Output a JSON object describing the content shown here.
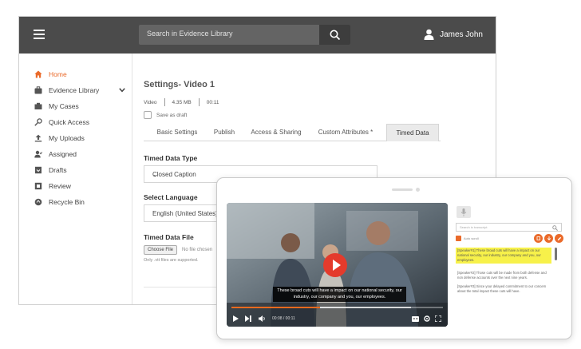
{
  "header": {
    "search_placeholder": "Search in Evidence Library",
    "user_name": "James John"
  },
  "sidebar": {
    "items": [
      {
        "label": "Home",
        "icon": "home-icon",
        "active": true
      },
      {
        "label": "Evidence Library",
        "icon": "briefcase-icon",
        "expandable": true
      },
      {
        "label": "My Cases",
        "icon": "case-icon"
      },
      {
        "label": "Quick Access",
        "icon": "key-icon"
      },
      {
        "label": "My Uploads",
        "icon": "upload-icon"
      },
      {
        "label": "Assigned",
        "icon": "assigned-user-icon"
      },
      {
        "label": "Drafts",
        "icon": "drafts-icon"
      },
      {
        "label": "Review",
        "icon": "review-icon"
      },
      {
        "label": "Recycle Bin",
        "icon": "recycle-icon"
      }
    ]
  },
  "main": {
    "title": "Settings- Video 1",
    "meta": {
      "type": "Video",
      "size": "4.35 MB",
      "duration": "00:11"
    },
    "draft_label": "Save as draft",
    "tabs": [
      "Basic Settings",
      "Publish",
      "Access & Sharing",
      "Custom Attributes *",
      "Timed Data"
    ],
    "active_tab": "Timed Data",
    "timed_data_type": {
      "label": "Timed Data Type",
      "value": "Closed Caption"
    },
    "language": {
      "label": "Select Language",
      "value": "English (United States)"
    },
    "timed_data_file": {
      "label": "Timed Data File",
      "button": "Choose File",
      "status": "No file chosen",
      "note": "Only .vtt files are supported."
    }
  },
  "player": {
    "caption": "These broad cuts will have a impact on our national security, our industry, our company and you, our employees.",
    "time": "00:08 / 00:11",
    "progress": 0.42,
    "buffered": 0.85
  },
  "transcript_panel": {
    "search_placeholder": "Search in transcript",
    "autoscroll_label": "Auto scroll",
    "entries": [
      "[Speaker#1] These broad cuts will have a impact on our national security, our industry, our company and you, our employees.",
      "[Speaker#2] Those cuts will be made from both defense and non defense accounts over the next nine years.",
      "[Speaker#3] Since your delayed commitment to our concern about the total impact these cuts will have."
    ]
  },
  "colors": {
    "accent": "#ea6a2a",
    "topbar": "#4b4b4b",
    "highlight": "#f7f14a",
    "play": "#e43b2c"
  }
}
